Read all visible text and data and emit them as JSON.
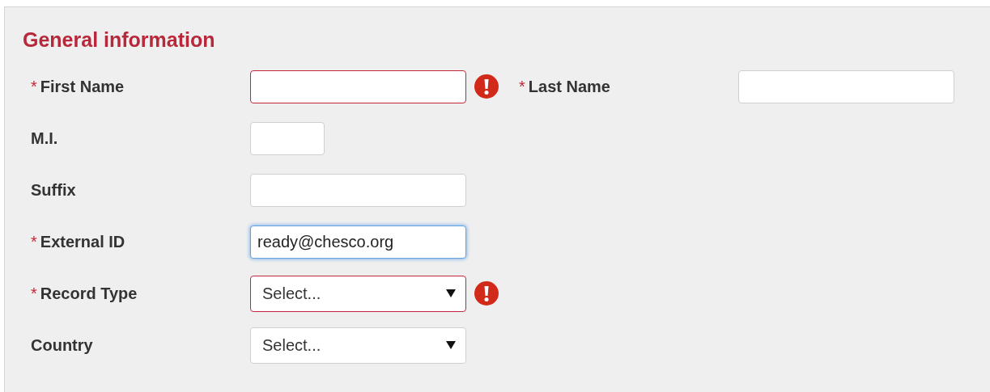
{
  "section": {
    "title": "General information"
  },
  "rows": [
    {
      "fields": [
        {
          "label": "First Name",
          "kind": "text",
          "marker": "*",
          "error": true,
          "focused": false
        },
        {
          "label": "Last Name",
          "kind": "text",
          "marker": "*",
          "error": false,
          "focused": false
        }
      ]
    },
    {
      "fields": [
        {
          "label": "M.I.",
          "kind": "short",
          "error": false,
          "focused": false
        }
      ]
    },
    {
      "fields": [
        {
          "label": "Suffix",
          "kind": "text",
          "error": false,
          "focused": false
        }
      ]
    },
    {
      "fields": [
        {
          "label": "External ID",
          "kind": "text",
          "marker": "*",
          "error": false,
          "focused": true,
          "value": "ready@chesco.org"
        }
      ]
    },
    {
      "fields": [
        {
          "label": "Record Type",
          "kind": "select",
          "marker": "*",
          "error": true,
          "value": "Select..."
        }
      ]
    },
    {
      "fields": [
        {
          "label": "Country",
          "kind": "select",
          "error": false,
          "value": "Select..."
        }
      ]
    }
  ]
}
